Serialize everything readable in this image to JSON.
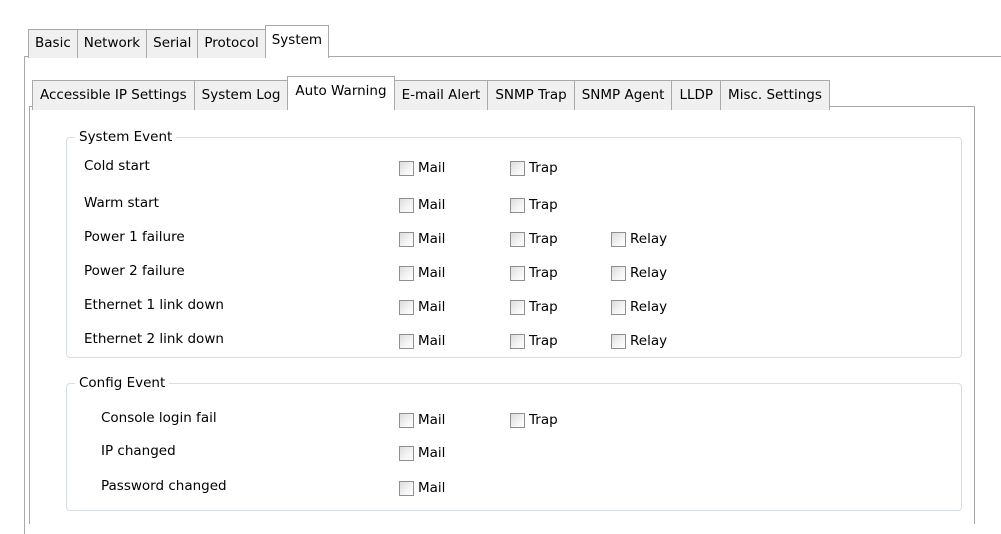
{
  "top_tabs": [
    "Basic",
    "Network",
    "Serial",
    "Protocol",
    "System"
  ],
  "top_active": "System",
  "sub_tabs": [
    "Accessible IP Settings",
    "System Log",
    "Auto Warning",
    "E-mail Alert",
    "SNMP Trap",
    "SNMP Agent",
    "LLDP",
    "Misc. Settings"
  ],
  "sub_active": "Auto Warning",
  "system_event": {
    "legend": "System Event",
    "rows": [
      {
        "label": "Cold start",
        "mail": "Mail",
        "trap": "Trap",
        "relay": ""
      },
      {
        "label": "Warm start",
        "mail": "Mail",
        "trap": "Trap",
        "relay": ""
      },
      {
        "label": "Power 1 failure",
        "mail": "Mail",
        "trap": "Trap",
        "relay": "Relay"
      },
      {
        "label": "Power 2 failure",
        "mail": "Mail",
        "trap": "Trap",
        "relay": "Relay"
      },
      {
        "label": "Ethernet 1 link down",
        "mail": "Mail",
        "trap": "Trap",
        "relay": "Relay"
      },
      {
        "label": "Ethernet 2 link down",
        "mail": "Mail",
        "trap": "Trap",
        "relay": "Relay"
      }
    ]
  },
  "config_event": {
    "legend": "Config Event",
    "rows": [
      {
        "label": "Console login fail",
        "mail": "Mail",
        "trap": "Trap"
      },
      {
        "label": "IP changed",
        "mail": "Mail",
        "trap": ""
      },
      {
        "label": "Password changed",
        "mail": "Mail",
        "trap": ""
      }
    ]
  },
  "all_checked": false
}
